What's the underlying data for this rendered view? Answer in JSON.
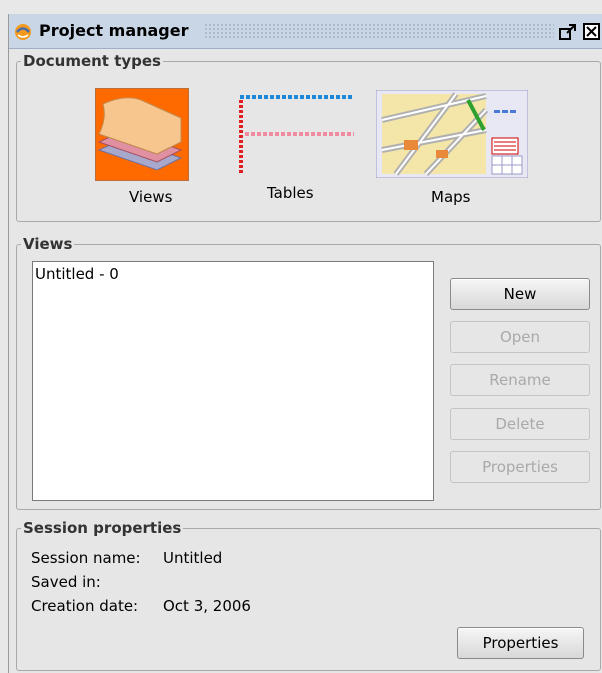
{
  "window": {
    "title": "Project manager"
  },
  "document_types": {
    "legend": "Document types",
    "items": [
      {
        "label": "Views",
        "icon": "views-icon"
      },
      {
        "label": "Tables",
        "icon": "tables-icon"
      },
      {
        "label": "Maps",
        "icon": "maps-icon"
      }
    ]
  },
  "views_panel": {
    "legend": "Views",
    "list": [
      "Untitled - 0"
    ],
    "buttons": {
      "new": "New",
      "open": "Open",
      "rename": "Rename",
      "delete": "Delete",
      "properties": "Properties"
    }
  },
  "session": {
    "legend": "Session properties",
    "name_label": "Session name:",
    "name_value": "Untitled",
    "saved_label": "Saved in:",
    "saved_value": "",
    "date_label": "Creation date:",
    "date_value": "Oct 3, 2006",
    "properties_button": "Properties"
  },
  "colors": {
    "titlebar": "#c9d6e6",
    "views_accent": "#ff6a00"
  }
}
